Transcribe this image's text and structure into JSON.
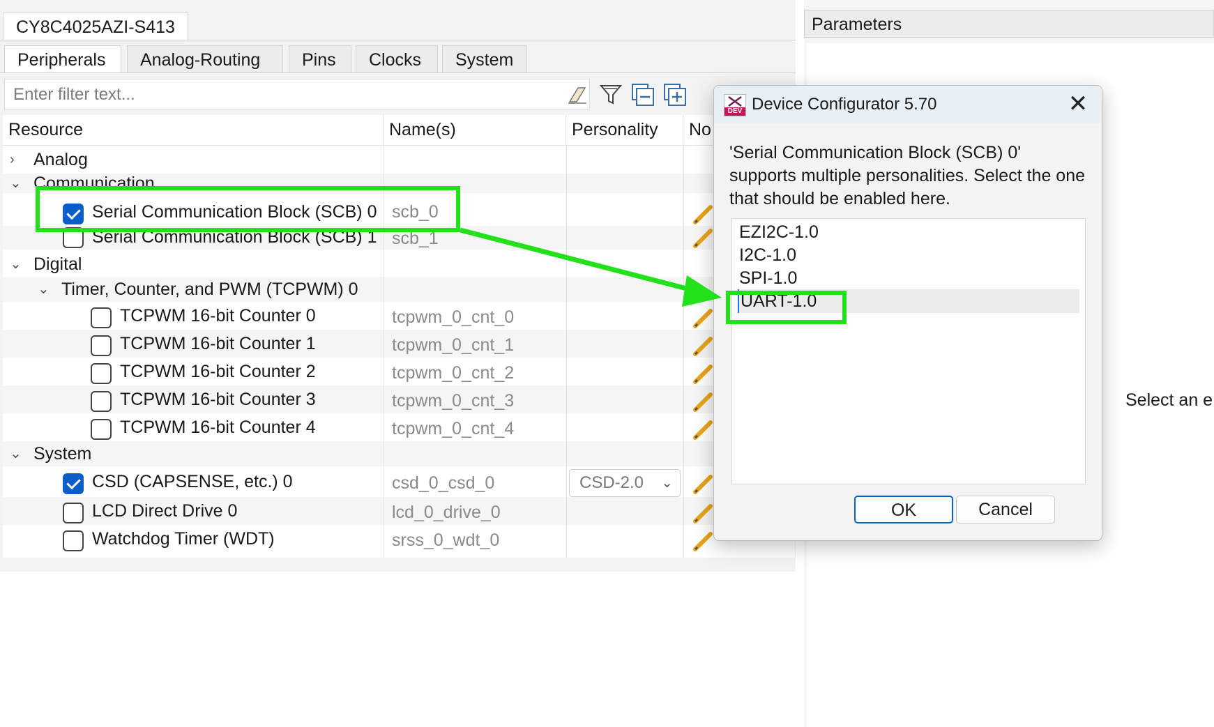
{
  "device_tab": "CY8C4025AZI-S413",
  "tabs": [
    "Peripherals",
    "Analog-Routing",
    "Pins",
    "Clocks",
    "System"
  ],
  "filter": {
    "placeholder": "Enter filter text..."
  },
  "toolbar": {
    "clear_icon": "eraser-icon",
    "filter_icon": "funnel-icon",
    "collapse_icon": "collapse-all-icon",
    "expand_icon": "expand-all-icon"
  },
  "columns": [
    "Resource",
    "Name(s)",
    "Personality",
    "No"
  ],
  "tree": {
    "analog": "Analog",
    "communication": "Communication",
    "scb0": {
      "label": "Serial Communication Block (SCB) 0",
      "name": "scb_0",
      "checked": true
    },
    "scb1": {
      "label": "Serial Communication Block (SCB) 1",
      "name": "scb_1",
      "checked": false
    },
    "digital": "Digital",
    "tcpwm_group": "Timer, Counter, and PWM (TCPWM) 0",
    "counters": [
      {
        "label": "TCPWM 16-bit Counter 0",
        "name": "tcpwm_0_cnt_0"
      },
      {
        "label": "TCPWM 16-bit Counter 1",
        "name": "tcpwm_0_cnt_1"
      },
      {
        "label": "TCPWM 16-bit Counter 2",
        "name": "tcpwm_0_cnt_2"
      },
      {
        "label": "TCPWM 16-bit Counter 3",
        "name": "tcpwm_0_cnt_3"
      },
      {
        "label": "TCPWM 16-bit Counter 4",
        "name": "tcpwm_0_cnt_4"
      }
    ],
    "system": "System",
    "csd": {
      "label": "CSD (CAPSENSE, etc.) 0",
      "name": "csd_0_csd_0",
      "personality": "CSD-2.0",
      "checked": true
    },
    "lcd": {
      "label": "LCD Direct Drive 0",
      "name": "lcd_0_drive_0"
    },
    "wdt": {
      "label": "Watchdog Timer (WDT)",
      "name": "srss_0_wdt_0"
    }
  },
  "parameters": {
    "title": "Parameters",
    "hint": "Select an e"
  },
  "dialog": {
    "title": "Device Configurator 5.70",
    "icon_tag": "DEV",
    "message": "'Serial Communication Block (SCB) 0' supports multiple personalities. Select the one that should be enabled here.",
    "options": [
      "EZI2C-1.0",
      "I2C-1.0",
      "SPI-1.0",
      "UART-1.0"
    ],
    "selected": "UART-1.0",
    "ok": "OK",
    "cancel": "Cancel",
    "close": "✕"
  },
  "colors": {
    "highlight": "#22e01a",
    "accent": "#0a5ec9"
  }
}
